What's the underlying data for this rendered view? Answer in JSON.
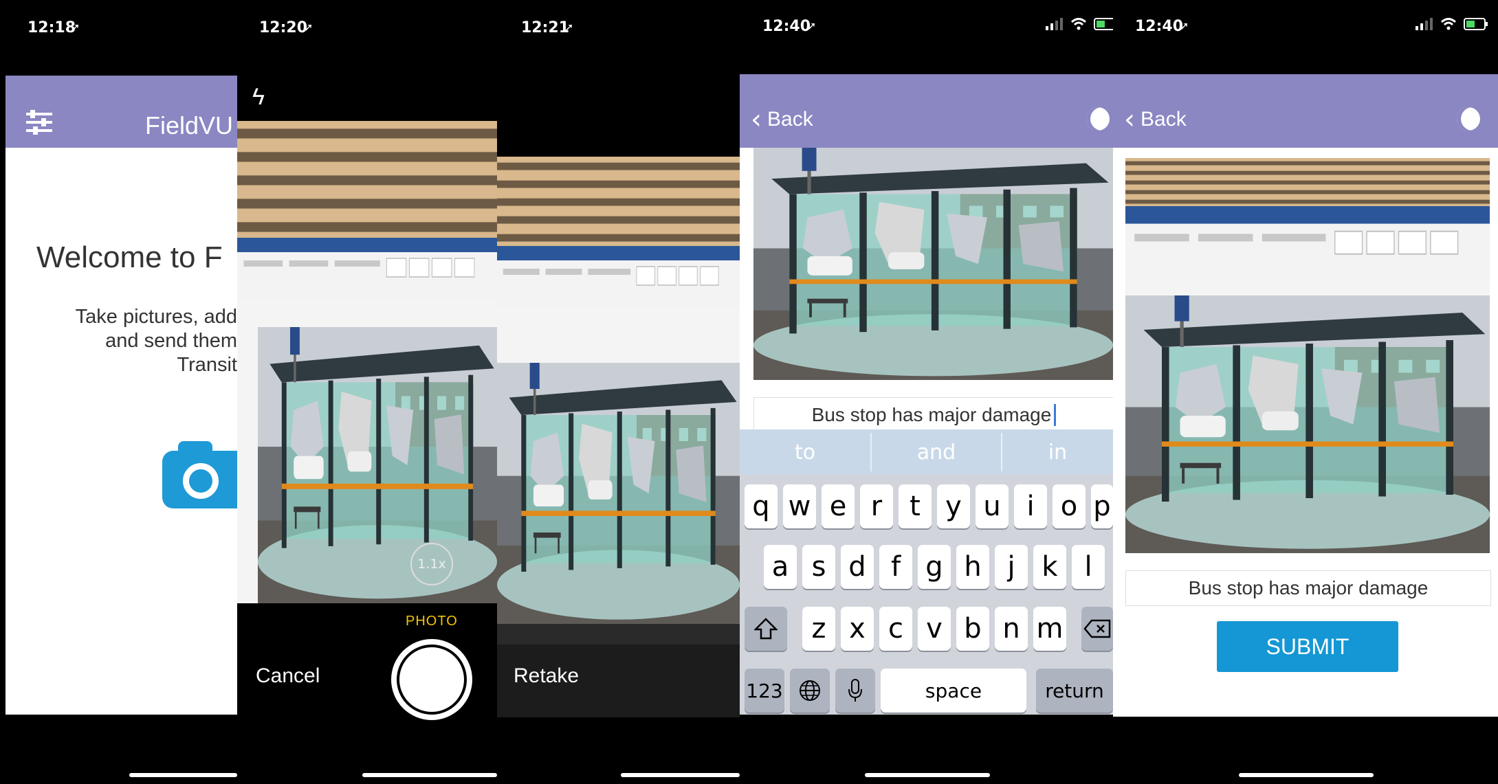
{
  "panel1": {
    "time": "12:18",
    "app_title": "FieldVU",
    "welcome": "Welcome to F",
    "desc_lines": [
      "Take pictures, add",
      "and send them",
      "Transit"
    ]
  },
  "panel2": {
    "time": "12:20",
    "zoom": "1.1x",
    "mode": "PHOTO",
    "cancel": "Cancel"
  },
  "panel3": {
    "time": "12:21",
    "retake": "Retake"
  },
  "panel4": {
    "time": "12:40",
    "back": "Back",
    "caption": "Bus stop has major damage",
    "suggestions": [
      "to",
      "and",
      "in"
    ],
    "row1": [
      "q",
      "w",
      "e",
      "r",
      "t",
      "y",
      "u",
      "i",
      "o",
      "p"
    ],
    "row2": [
      "a",
      "s",
      "d",
      "f",
      "g",
      "h",
      "j",
      "k",
      "l"
    ],
    "row3": [
      "z",
      "x",
      "c",
      "v",
      "b",
      "n",
      "m"
    ],
    "key_123": "123",
    "key_space": "space",
    "key_return": "return"
  },
  "panel5": {
    "time": "12:40",
    "back": "Back",
    "caption": "Bus stop has major damage",
    "submit": "SUBMIT"
  },
  "colors": {
    "header_purple": "#8a87c2",
    "camera_blue": "#1e9ad6",
    "submit_blue": "#1497d4",
    "photo_mode_yellow": "#f5c400",
    "keyboard_bg": "#d1d4db"
  }
}
